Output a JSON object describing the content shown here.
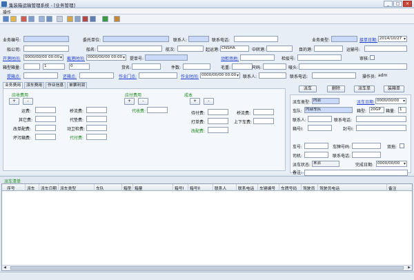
{
  "window": {
    "title": "集装箱运输管理系统 - [业务管理]",
    "min": "_",
    "max": "□",
    "close": "×"
  },
  "menu": {
    "item": "操作"
  },
  "row1": {
    "order_no_label": "业务编号:",
    "entrust_label": "委托单位:",
    "contact_label": "联系人:",
    "phone_label": "联系电话:",
    "biz_type_label": "业务类型:",
    "accept_date_label": "接单日期:",
    "accept_date": "2014/10/27"
  },
  "row2": {
    "carrier_label": "船公司:",
    "vessel_label": "船名:",
    "voyage_label": "航次:",
    "port_label": "起运港:",
    "port_value": "CNSHA",
    "transit_label": "中转港:",
    "dest_label": "目的港:",
    "transit_no_label": "运输号:"
  },
  "row3": {
    "open_time_label": "开港时间:",
    "open_time": "0000/00/00 00:00",
    "close_time_label": "截港时间:",
    "close_time": "0000/00/00 00:00",
    "bl_label": "提单号:",
    "yard_label": "动柜场地:",
    "inspect_label": "检疫号:",
    "audit_label": "审核:"
  },
  "row4": {
    "box_qty_label": "箱型箱量:",
    "box_qty": "1",
    "box_size": "0",
    "goods_label": "货名:",
    "pieces_label": "件数:",
    "gross_label": "毛重:",
    "volume_label": "尺码:",
    "shipping_mark_label": "唛头:"
  },
  "row5": {
    "load_place_label": "提箱点:",
    "return_place_label": "还箱点:",
    "work_gate_label": "作业门点:",
    "work_time_label": "作业时间:",
    "work_time": "0000/00/00 00:00",
    "contact_label": "联系人:",
    "phone_label": "联系电话:",
    "operator_label": "操作员:",
    "operator": "adm"
  },
  "tabs": [
    "业务费用",
    "派车费用",
    "作业信息",
    "单票利润"
  ],
  "fees": {
    "receivable_title": "应收费用",
    "payable_title": "应付费用",
    "cost_title": "成本",
    "plus": "+",
    "minus": "-",
    "recv_items": [
      "运费:",
      "其它费:",
      "改单配费:",
      "坏污箱费:"
    ],
    "recv_items2": [
      "桥流费:",
      "代垫费:",
      "动卫检费:",
      "代付费:"
    ],
    "pay_item": "代收费:",
    "cost_items": [
      "待付费:",
      "打单费:",
      "改配费:"
    ],
    "cost_items2": [
      "桥流费:",
      "上下车费:"
    ]
  },
  "actions": {
    "dispatch": "派车",
    "delete": "删除",
    "dispatch_list": "派车单",
    "load_list": "装箱单"
  },
  "dispatch": {
    "type_label": "派车类型:",
    "type_value": "内派",
    "date_label": "派车日期:",
    "date_value": "0000/00/00",
    "fleet_label": "车队:",
    "fleet_value": "内部车队",
    "box_type_label": "箱型:",
    "box_type_value": "20GP",
    "box_qty_label": "箱量:",
    "box_qty_value": "1",
    "contact_label": "联系人:",
    "phone_label": "联系电话:",
    "box_no_label": "箱号I:",
    "seal_label": "封号I:",
    "truck_no_label": "车号:",
    "plate_label": "车牌号码:",
    "driver_label": "司机:",
    "driver_phone_label": "联系电话:",
    "status_label": "派车状态:",
    "status_value": "未派",
    "finish_date_label": "完成日期:",
    "finish_date_value": "0000/00/00",
    "remark_label": "备注:",
    "dual_label": "双拖:"
  },
  "grid": {
    "title": "派车清单",
    "columns": [
      "序号",
      "派车",
      "派车日期",
      "派车类型",
      "车队",
      "箱型",
      "箱量",
      "箱号I",
      "箱号II",
      "联系人",
      "联系电话",
      "车辆编号",
      "车牌号码",
      "驾驶员",
      "驾驶员电话",
      "备注"
    ]
  },
  "colors": {
    "accent": "#1a3bd1",
    "required": "#c9d9f7",
    "green": "#1b8a1b"
  },
  "toolbar_icons": [
    "save-icon",
    "edit-icon",
    "delete-icon",
    "cancel-icon",
    "copy-icon",
    "paste-icon",
    "import-icon",
    "export-icon",
    "print-icon",
    "report-icon",
    "calendar-icon",
    "grid-icon",
    "tree-icon",
    "exit-icon"
  ]
}
